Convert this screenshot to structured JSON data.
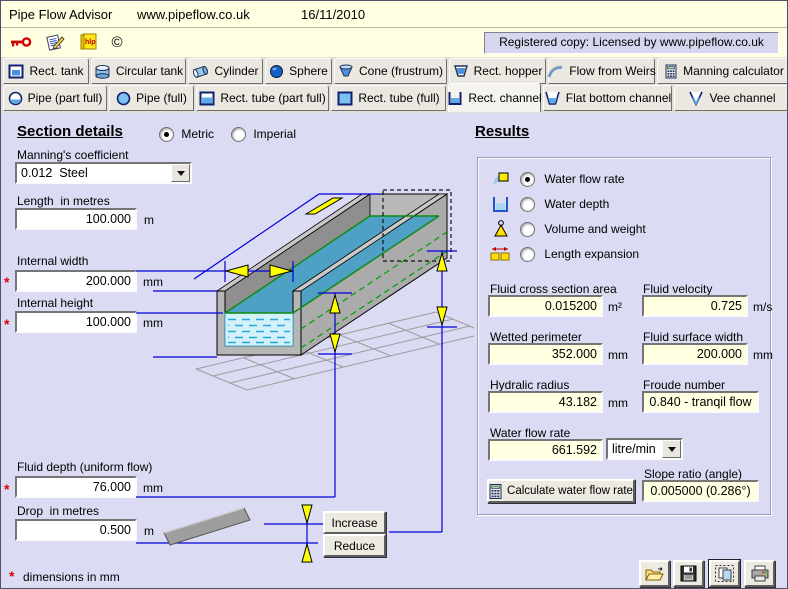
{
  "window": {
    "title": "Pipe Flow Advisor",
    "website": "www.pipeflow.co.uk",
    "date": "16/11/2010",
    "registered_notice": "Registered copy: Licensed by www.pipeflow.co.uk"
  },
  "toolbar": {
    "icons": [
      {
        "name": "key-icon"
      },
      {
        "name": "register-icon"
      },
      {
        "name": "help-icon",
        "glyph": "hlp"
      },
      {
        "name": "copyright-icon",
        "glyph": "©"
      }
    ]
  },
  "tabs": {
    "row1": [
      {
        "label": "Rect. tank",
        "icon": "rect-tank-icon"
      },
      {
        "label": "Circular tank",
        "icon": "circular-tank-icon"
      },
      {
        "label": "Cylinder",
        "icon": "cylinder-icon"
      },
      {
        "label": "Sphere",
        "icon": "sphere-icon"
      },
      {
        "label": "Cone (frustrum)",
        "icon": "cone-icon"
      },
      {
        "label": "Rect. hopper",
        "icon": "hopper-icon"
      },
      {
        "label": "Flow from Weirs",
        "icon": "weir-icon"
      },
      {
        "label": "Manning calculator",
        "icon": "calculator-icon"
      }
    ],
    "row2": [
      {
        "label": "Pipe (part full)",
        "icon": "pipe-part-full-icon"
      },
      {
        "label": "Pipe (full)",
        "icon": "pipe-full-icon"
      },
      {
        "label": "Rect. tube (part full)",
        "icon": "rect-tube-part-full-icon"
      },
      {
        "label": "Rect. tube (full)",
        "icon": "rect-tube-full-icon"
      },
      {
        "label": "Rect. channel",
        "icon": "rect-channel-icon",
        "active": true
      },
      {
        "label": "Flat bottom channel",
        "icon": "flat-bottom-channel-icon"
      },
      {
        "label": "Vee channel",
        "icon": "vee-channel-icon"
      }
    ]
  },
  "section": {
    "heading": "Section details",
    "unit_options": [
      {
        "label": "Metric",
        "selected": true
      },
      {
        "label": "Imperial",
        "selected": false
      }
    ],
    "manning": {
      "label": "Manning's coefficient",
      "value": "0.012  Steel"
    },
    "length": {
      "label": "Length  in metres",
      "value": "100.000",
      "unit": "m"
    },
    "internal_width": {
      "label": "Internal width",
      "value": "200.000",
      "unit": "mm",
      "required_mark": "*"
    },
    "internal_height": {
      "label": "Internal height",
      "value": "100.000",
      "unit": "mm",
      "required_mark": "*"
    },
    "fluid_depth": {
      "label": "Fluid depth (uniform flow)",
      "value": "76.000",
      "unit": "mm",
      "required_mark": "*"
    },
    "drop": {
      "label": "Drop  in metres",
      "value": "0.500",
      "unit": "m"
    },
    "increase_button": "Increase",
    "reduce_button": "Reduce",
    "footnote": {
      "mark": "*",
      "text": "dimensions in mm"
    }
  },
  "results": {
    "heading": "Results",
    "options": [
      {
        "label": "Water flow rate",
        "selected": true,
        "icon": "flow-rate-icon"
      },
      {
        "label": "Water depth",
        "selected": false,
        "icon": "water-depth-icon"
      },
      {
        "label": "Volume and weight",
        "selected": false,
        "icon": "volume-weight-icon"
      },
      {
        "label": "Length expansion",
        "selected": false,
        "icon": "length-expansion-icon"
      }
    ],
    "cross_section_area": {
      "label": "Fluid cross section area",
      "value": "0.015200",
      "unit": "m²"
    },
    "fluid_velocity": {
      "label": "Fluid velocity",
      "value": "0.725",
      "unit": "m/s"
    },
    "wetted_perimeter": {
      "label": "Wetted perimeter",
      "value": "352.000",
      "unit": "mm"
    },
    "fluid_surface_width": {
      "label": "Fluid surface width",
      "value": "200.000",
      "unit": "mm"
    },
    "hydraulic_radius": {
      "label": "Hydralic radius",
      "value": "43.182",
      "unit": "mm"
    },
    "froude_number": {
      "label": "Froude number",
      "value": "0.840 - tranqil flow"
    },
    "water_flow_rate": {
      "label": "Water flow rate",
      "value": "661.592",
      "unit_selected": "litre/min"
    },
    "calculate_button": "Calculate water flow rate",
    "slope_ratio": {
      "label": "Slope ratio (angle)",
      "value": "0.005000 (0.286°)"
    }
  },
  "footer_buttons": [
    {
      "name": "open-button"
    },
    {
      "name": "save-button"
    },
    {
      "name": "copy-button"
    },
    {
      "name": "print-button"
    }
  ],
  "colors": {
    "titlebar_bg": "#FFFFE1",
    "main_bg": "#DBDBF3",
    "result_field_bg": "#FFFFE1",
    "dimension_line": "#0000DC",
    "arrow_fill": "#FFFF00",
    "required_mark": "#E00000",
    "water_surface": "#4FA0C5",
    "water_front": "#D2F1F8"
  }
}
